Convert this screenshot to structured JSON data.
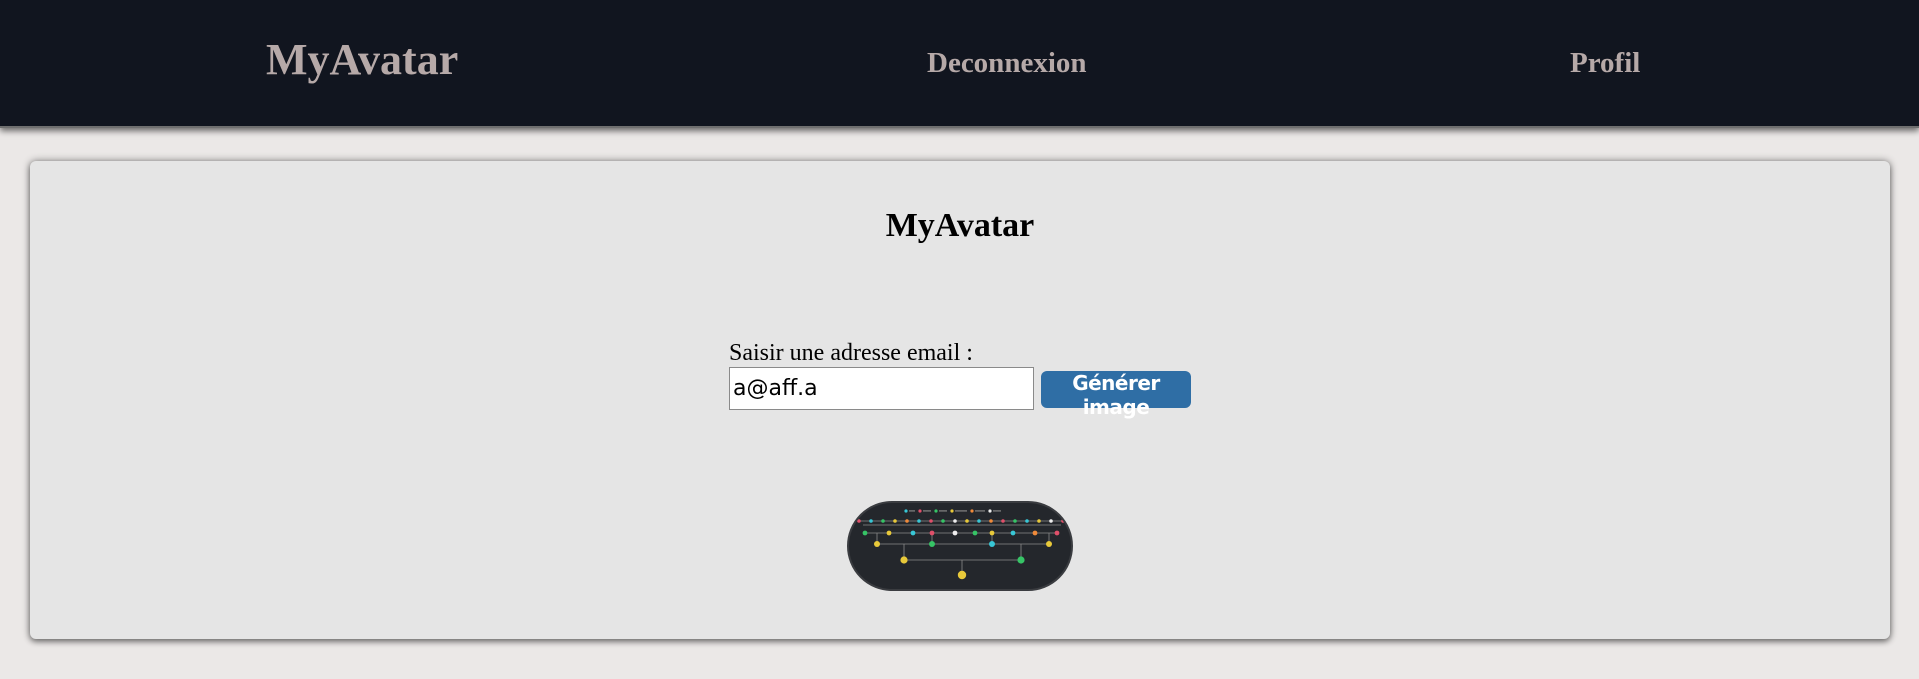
{
  "navbar": {
    "brand": "MyAvatar",
    "logout_label": "Deconnexion",
    "profile_label": "Profil"
  },
  "main": {
    "title": "MyAvatar",
    "email_label": "Saisir une adresse email :",
    "email_value": "a@aff.a",
    "generate_label": "Générer image"
  },
  "colors": {
    "navbar_bg": "#11151f",
    "nav_text": "#b6a9a8",
    "page_bg": "#ebe8e7",
    "card_bg": "#e5e5e5",
    "button_bg": "#2f6ea5",
    "avatar_bg": "#24272c"
  },
  "avatar": {
    "icon": "generated-avatar-image"
  }
}
